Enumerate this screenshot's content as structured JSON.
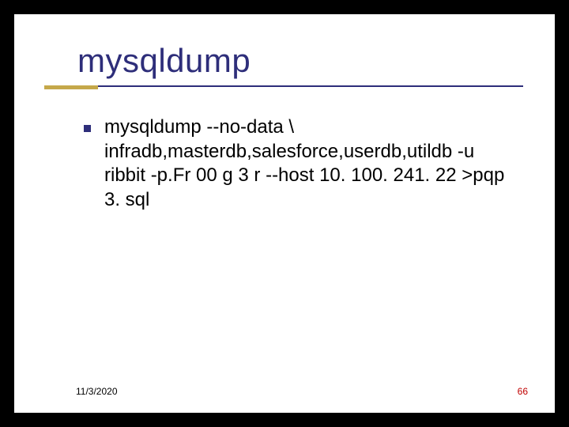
{
  "slide": {
    "title": "mysqldump",
    "body": "mysqldump --no-data  \\ infradb,masterdb,salesforce,userdb,utildb -u ribbit  -p.Fr 00 g 3 r --host 10. 100. 241. 22 >pqp 3. sql",
    "footer_date": "11/3/2020",
    "page_number": "66"
  }
}
